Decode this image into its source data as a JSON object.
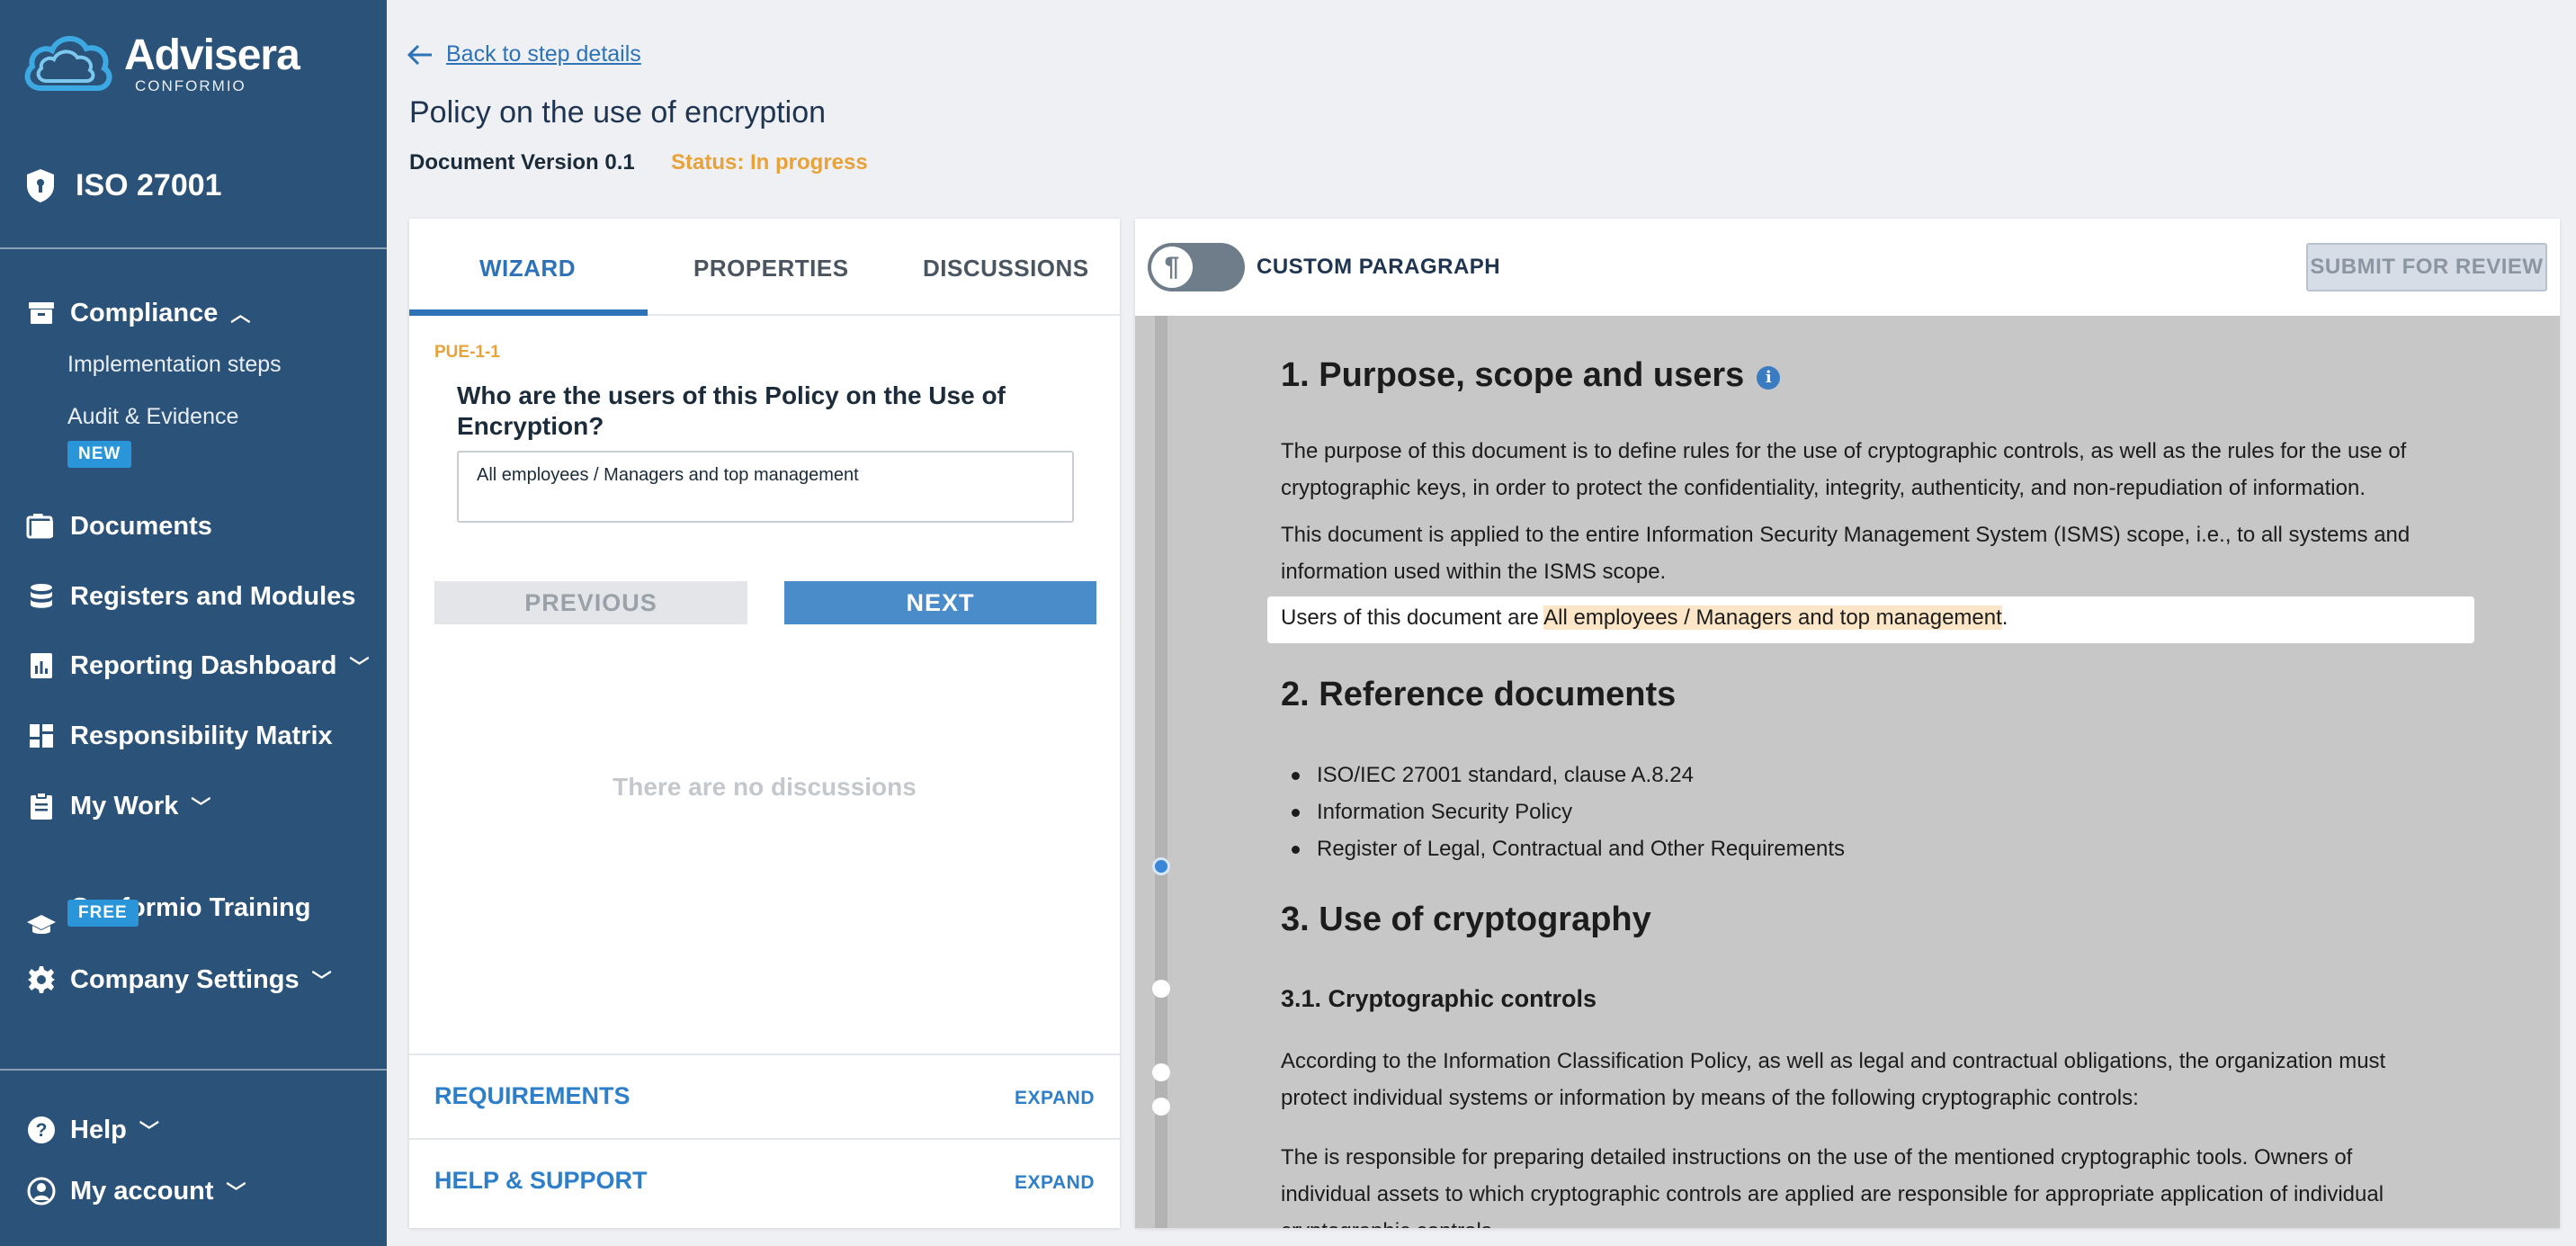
{
  "brand": {
    "name": "Advisera",
    "sub": "CONFORMIO"
  },
  "product": {
    "name": "ISO 27001"
  },
  "sidebar": {
    "items": [
      {
        "label": "Compliance",
        "icon": "archive-icon"
      },
      {
        "label": "Documents",
        "icon": "folder-icon"
      },
      {
        "label": "Registers and Modules",
        "icon": "database-icon"
      },
      {
        "label": "Reporting Dashboard",
        "icon": "report-icon"
      },
      {
        "label": "Responsibility Matrix",
        "icon": "grid-icon"
      },
      {
        "label": "My Work",
        "icon": "clipboard-icon"
      },
      {
        "label": "Conformio Training",
        "icon": "graduation-cap-icon"
      },
      {
        "label": "Company Settings",
        "icon": "gear-icon"
      }
    ],
    "sub_items": [
      {
        "label": "Implementation steps"
      },
      {
        "label": "Audit & Evidence"
      }
    ],
    "badges": {
      "new": "NEW",
      "free": "FREE"
    },
    "bottom": [
      {
        "label": "Help",
        "icon": "help-icon"
      },
      {
        "label": "My account",
        "icon": "user-icon"
      }
    ]
  },
  "header": {
    "back_label": "Back to step details",
    "title": "Policy on the use of encryption",
    "version": "Document Version 0.1",
    "status": "Status: In progress"
  },
  "left": {
    "tabs": [
      {
        "label": "WIZARD"
      },
      {
        "label": "PROPERTIES"
      },
      {
        "label": "DISCUSSIONS"
      }
    ],
    "question_id": "PUE-1-1",
    "question": "Who are the users of this Policy on the Use of Encryption?",
    "answer": "All employees / Managers and top management",
    "previous_label": "PREVIOUS",
    "next_label": "NEXT",
    "no_discussions": "There are no discussions",
    "accordions": [
      {
        "title": "REQUIREMENTS",
        "action": "EXPAND"
      },
      {
        "title": "HELP & SUPPORT",
        "action": "EXPAND"
      }
    ]
  },
  "right": {
    "toggle_label": "CUSTOM PARAGRAPH",
    "submit_label": "SUBMIT FOR REVIEW",
    "doc": {
      "h1_1": "1. Purpose, scope and users",
      "p1": "The purpose of this document is to define rules for the use of cryptographic controls, as well as the rules for the use of cryptographic keys, in order to protect the confidentiality, integrity, authenticity, and non-repudiation of information.",
      "p2": "This document is applied to the entire Information Security Management System (ISMS) scope, i.e., to all systems and information used within the ISMS scope.",
      "users_prefix": "Users of this document are ",
      "users_value": "All employees / Managers and top management",
      "users_suffix": ".",
      "h1_2": "2. Reference documents",
      "refs": [
        "ISO/IEC 27001 standard, clause A.8.24",
        "Information Security Policy",
        "Register of Legal, Contractual and Other Requirements"
      ],
      "h1_3": "3. Use of cryptography",
      "h2_1": "3.1. Cryptographic controls",
      "p3": "According to the Information Classification Policy, as well as legal and contractual obligations, the organization must protect individual systems or information by means of the following cryptographic controls:",
      "p4": "The is responsible for preparing detailed instructions on the use of the mentioned cryptographic tools. Owners of individual assets to which cryptographic controls are applied are responsible for appropriate application of individual cryptographic controls."
    }
  },
  "colors": {
    "sidebar": "#2b5278",
    "accent": "#2e72b8",
    "status": "#e8a23a",
    "badge": "#2a95d8",
    "highlight": "#fde6c7"
  }
}
